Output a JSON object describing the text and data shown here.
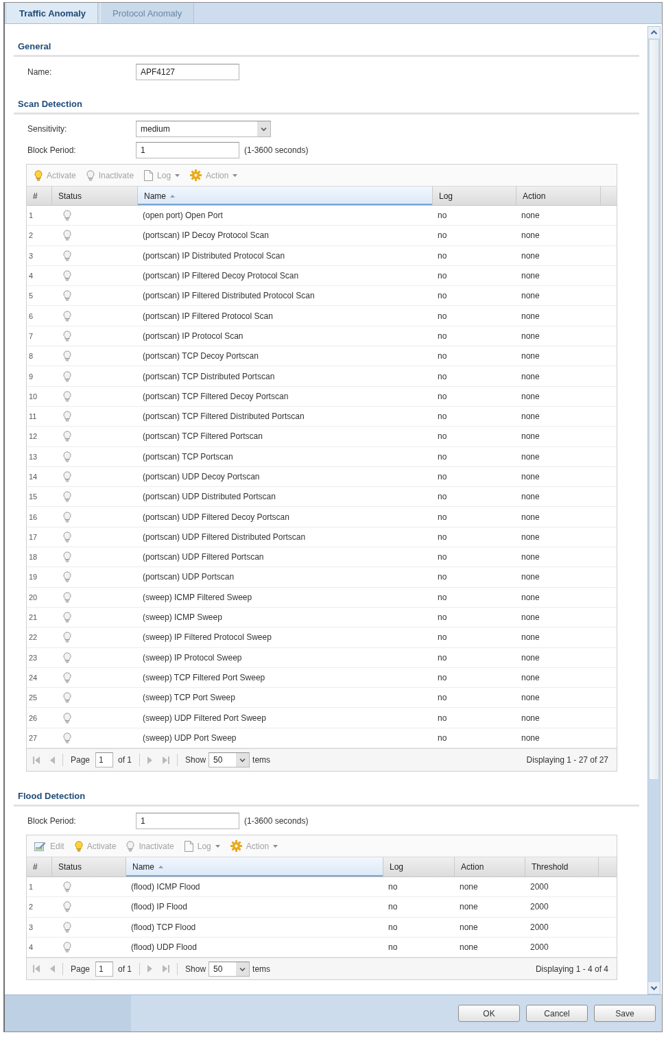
{
  "tabs": [
    {
      "label": "Traffic Anomaly",
      "selected": true
    },
    {
      "label": "Protocol Anomaly",
      "selected": false
    }
  ],
  "general": {
    "title": "General",
    "fields": [
      {
        "kind": "text",
        "label": "Name:",
        "value": "APF4127"
      }
    ]
  },
  "scan_detection": {
    "title": "Scan Detection",
    "fields": [
      {
        "kind": "select",
        "label": "Sensitivity:",
        "value": "medium"
      },
      {
        "kind": "text",
        "label": "Block Period:",
        "value": "1",
        "hint": "(1-3600 seconds)"
      }
    ],
    "grid": {
      "toolbar": [
        {
          "kind": "activate",
          "label": "Activate",
          "disabled": true,
          "menu": false
        },
        {
          "kind": "inactivate",
          "label": "Inactivate",
          "disabled": true,
          "menu": false
        },
        {
          "kind": "log",
          "label": "Log",
          "disabled": true,
          "menu": true
        },
        {
          "kind": "action",
          "label": "Action",
          "disabled": true,
          "menu": true
        }
      ],
      "columns": [
        {
          "label": "#",
          "kind": "index",
          "sorted": false
        },
        {
          "label": "Status",
          "kind": "status",
          "sorted": false
        },
        {
          "label": "Name",
          "kind": "text",
          "sorted": true
        },
        {
          "label": "Log",
          "kind": "text",
          "sorted": false
        },
        {
          "label": "Action",
          "kind": "text",
          "sorted": false
        }
      ],
      "rows": [
        {
          "active": false,
          "cells": [
            "1",
            "",
            "(open port) Open Port",
            "no",
            "none"
          ]
        },
        {
          "active": false,
          "cells": [
            "2",
            "",
            "(portscan) IP Decoy Protocol Scan",
            "no",
            "none"
          ]
        },
        {
          "active": false,
          "cells": [
            "3",
            "",
            "(portscan) IP Distributed Protocol Scan",
            "no",
            "none"
          ]
        },
        {
          "active": false,
          "cells": [
            "4",
            "",
            "(portscan) IP Filtered Decoy Protocol Scan",
            "no",
            "none"
          ]
        },
        {
          "active": false,
          "cells": [
            "5",
            "",
            "(portscan) IP Filtered Distributed Protocol Scan",
            "no",
            "none"
          ]
        },
        {
          "active": false,
          "cells": [
            "6",
            "",
            "(portscan) IP Filtered Protocol Scan",
            "no",
            "none"
          ]
        },
        {
          "active": false,
          "cells": [
            "7",
            "",
            "(portscan) IP Protocol Scan",
            "no",
            "none"
          ]
        },
        {
          "active": false,
          "cells": [
            "8",
            "",
            "(portscan) TCP Decoy Portscan",
            "no",
            "none"
          ]
        },
        {
          "active": false,
          "cells": [
            "9",
            "",
            "(portscan) TCP Distributed Portscan",
            "no",
            "none"
          ]
        },
        {
          "active": false,
          "cells": [
            "10",
            "",
            "(portscan) TCP Filtered Decoy Portscan",
            "no",
            "none"
          ]
        },
        {
          "active": false,
          "cells": [
            "11",
            "",
            "(portscan) TCP Filtered Distributed Portscan",
            "no",
            "none"
          ]
        },
        {
          "active": false,
          "cells": [
            "12",
            "",
            "(portscan) TCP Filtered Portscan",
            "no",
            "none"
          ]
        },
        {
          "active": false,
          "cells": [
            "13",
            "",
            "(portscan) TCP Portscan",
            "no",
            "none"
          ]
        },
        {
          "active": false,
          "cells": [
            "14",
            "",
            "(portscan) UDP Decoy Portscan",
            "no",
            "none"
          ]
        },
        {
          "active": false,
          "cells": [
            "15",
            "",
            "(portscan) UDP Distributed Portscan",
            "no",
            "none"
          ]
        },
        {
          "active": false,
          "cells": [
            "16",
            "",
            "(portscan) UDP Filtered Decoy Portscan",
            "no",
            "none"
          ]
        },
        {
          "active": false,
          "cells": [
            "17",
            "",
            "(portscan) UDP Filtered Distributed Portscan",
            "no",
            "none"
          ]
        },
        {
          "active": false,
          "cells": [
            "18",
            "",
            "(portscan) UDP Filtered Portscan",
            "no",
            "none"
          ]
        },
        {
          "active": false,
          "cells": [
            "19",
            "",
            "(portscan) UDP Portscan",
            "no",
            "none"
          ]
        },
        {
          "active": false,
          "cells": [
            "20",
            "",
            "(sweep) ICMP Filtered Sweep",
            "no",
            "none"
          ]
        },
        {
          "active": false,
          "cells": [
            "21",
            "",
            "(sweep) ICMP Sweep",
            "no",
            "none"
          ]
        },
        {
          "active": false,
          "cells": [
            "22",
            "",
            "(sweep) IP Filtered Protocol Sweep",
            "no",
            "none"
          ]
        },
        {
          "active": false,
          "cells": [
            "23",
            "",
            "(sweep) IP Protocol Sweep",
            "no",
            "none"
          ]
        },
        {
          "active": false,
          "cells": [
            "24",
            "",
            "(sweep) TCP Filtered Port Sweep",
            "no",
            "none"
          ]
        },
        {
          "active": false,
          "cells": [
            "25",
            "",
            "(sweep) TCP Port Sweep",
            "no",
            "none"
          ]
        },
        {
          "active": false,
          "cells": [
            "26",
            "",
            "(sweep) UDP Filtered Port Sweep",
            "no",
            "none"
          ]
        },
        {
          "active": false,
          "cells": [
            "27",
            "",
            "(sweep) UDP Port Sweep",
            "no",
            "none"
          ]
        }
      ],
      "pager": {
        "nav_disabled": true,
        "page_label": "Page",
        "page": "1",
        "of_label": "of 1",
        "show_label": "Show",
        "page_size": "50",
        "items_label": "tems",
        "summary": "Displaying 1 - 27 of 27"
      }
    }
  },
  "flood_detection": {
    "title": "Flood Detection",
    "fields": [
      {
        "kind": "text",
        "label": "Block Period:",
        "value": "1",
        "hint": "(1-3600 seconds)"
      }
    ],
    "grid": {
      "toolbar": [
        {
          "kind": "edit",
          "label": "Edit",
          "disabled": true,
          "menu": false
        },
        {
          "kind": "activate",
          "label": "Activate",
          "disabled": true,
          "menu": false
        },
        {
          "kind": "inactivate",
          "label": "Inactivate",
          "disabled": true,
          "menu": false
        },
        {
          "kind": "log",
          "label": "Log",
          "disabled": true,
          "menu": true
        },
        {
          "kind": "action",
          "label": "Action",
          "disabled": true,
          "menu": true
        }
      ],
      "columns": [
        {
          "label": "#",
          "kind": "index",
          "sorted": false
        },
        {
          "label": "Status",
          "kind": "status",
          "sorted": false
        },
        {
          "label": "Name",
          "kind": "text",
          "sorted": true
        },
        {
          "label": "Log",
          "kind": "text",
          "sorted": false
        },
        {
          "label": "Action",
          "kind": "text",
          "sorted": false
        },
        {
          "label": "Threshold",
          "kind": "text",
          "sorted": false
        }
      ],
      "rows": [
        {
          "active": false,
          "cells": [
            "1",
            "",
            "(flood) ICMP Flood",
            "no",
            "none",
            "2000"
          ]
        },
        {
          "active": false,
          "cells": [
            "2",
            "",
            "(flood) IP Flood",
            "no",
            "none",
            "2000"
          ]
        },
        {
          "active": false,
          "cells": [
            "3",
            "",
            "(flood) TCP Flood",
            "no",
            "none",
            "2000"
          ]
        },
        {
          "active": false,
          "cells": [
            "4",
            "",
            "(flood) UDP Flood",
            "no",
            "none",
            "2000"
          ]
        }
      ],
      "pager": {
        "nav_disabled": true,
        "page_label": "Page",
        "page": "1",
        "of_label": "of 1",
        "show_label": "Show",
        "page_size": "50",
        "items_label": "tems",
        "summary": "Displaying 1 - 4 of 4"
      }
    }
  },
  "buttons": [
    "OK",
    "Cancel",
    "Save"
  ]
}
